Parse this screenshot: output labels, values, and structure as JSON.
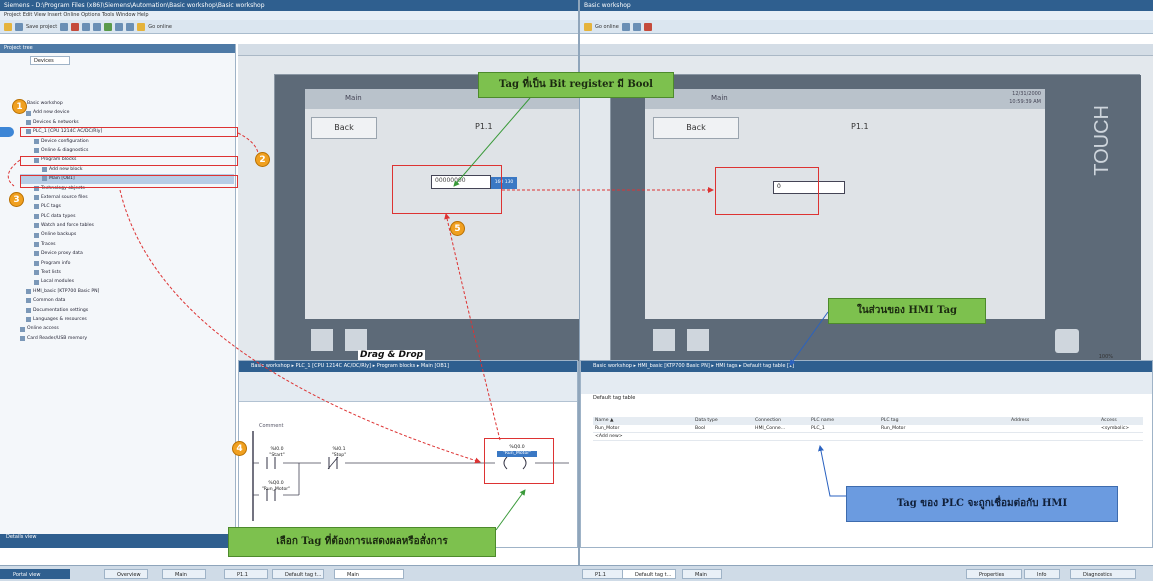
{
  "window": {
    "title_left": "Siemens - D:\\Program Files (x86)\\Siemens\\Automation\\Basic workshop\\Basic workshop",
    "title_right": "Basic workshop",
    "menu": "Project  Edit  View  Insert  Online  Options  Tools  Window  Help",
    "save_label": "Save project",
    "go_online": "Go online"
  },
  "tree": {
    "header": "Project tree",
    "tab": "Devices",
    "items": [
      "Basic workshop",
      "Add new device",
      "Devices & networks",
      "PLC_1 [CPU 1214C AC/DC/Rly]",
      "Device configuration",
      "Online & diagnostics",
      "Program blocks",
      "Add new block",
      "Main [OB1]",
      "Technology objects",
      "External source files",
      "PLC tags",
      "PLC data types",
      "Watch and force tables",
      "Online backups",
      "Traces",
      "Device proxy data",
      "Program info",
      "Text lists",
      "Local modules",
      "HMI_basic [KTP700 Basic PN]",
      "Common data",
      "Documentation settings",
      "Languages & resources",
      "Online access",
      "Card Reader/USB memory"
    ],
    "details": "Details view"
  },
  "hmi_left": {
    "title": "Main",
    "back": "Back",
    "screen_label": "P1.1",
    "io_value": "00000000",
    "io_value_side": "160 130"
  },
  "hmi_right": {
    "title": "Main",
    "back": "Back",
    "screen_label": "P1.1",
    "io_value": "0",
    "date": "12/31/2000",
    "time": "10:59:39 AM",
    "brand": "TOUCH"
  },
  "callouts": {
    "tag_bool": "Tag ที่เป็น Bit register มี Bool",
    "hmi_tag": "ในส่วนของ HMI Tag",
    "plc_tag": "Tag ของ PLC จะถูกเชื่อมต่อกับ HMI",
    "select_tag": "เลือก Tag ที่ต้องการแสดงผลหรือสั่งการ",
    "drag_drop": "Drag & Drop"
  },
  "badges": [
    "1",
    "2",
    "3",
    "4",
    "5"
  ],
  "ladder": {
    "breadcrumb": "Basic workshop  ▸  PLC_1 [CPU 1214C AC/DC/Rly]  ▸  Program blocks  ▸  Main [OB1]",
    "comment": "Comment",
    "contact1_addr": "%I0.0",
    "contact1_name": "\"Start\"",
    "contact2_addr": "%I0.1",
    "contact2_name": "\"Stop\"",
    "coil_addr": "%Q0.0",
    "coil_name": "\"Run_Motor\"",
    "contact3_addr": "%Q0.0",
    "contact3_name": "\"Run_Motor\""
  },
  "tagtable": {
    "breadcrumb": "Basic workshop  ▸  HMI_basic [KTP700 Basic PN]  ▸  HMI tags  ▸  Default tag table [1]",
    "title": "Default tag table",
    "columns": [
      "Name ▲",
      "Data type",
      "Connection",
      "PLC name",
      "PLC tag",
      "Address",
      "Access"
    ],
    "rows": [
      [
        "Run_Motor",
        "Bool",
        "HMI_Conne...",
        "PLC_1",
        "Run_Motor",
        "",
        "<symbolic>"
      ],
      [
        "<Add new>",
        "",
        "",
        "",
        "",
        "",
        ""
      ]
    ],
    "zoom": "100%"
  },
  "taskbar": {
    "portal": "Portal view",
    "items_left": [
      "Overview",
      "Main",
      "P1.1",
      "Default tag t...",
      "Main"
    ],
    "items_right": [
      "P1.1",
      "Default tag t...",
      "Main"
    ],
    "properties": "Properties",
    "info": "Info",
    "diagnostics": "Diagnostics"
  }
}
